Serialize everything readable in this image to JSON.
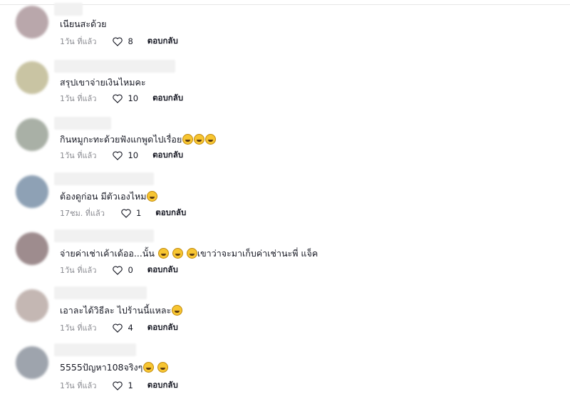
{
  "comments": [
    {
      "text": "เนียนสะด้วย",
      "time": "1วัน ที่แล้ว",
      "likes": "8",
      "reply": "ตอบกลับ",
      "emoji_count": 0,
      "avatar_color": "#b9a7ab"
    },
    {
      "text": "สรุปเขาจ่ายเงินไหมคะ",
      "time": "1วัน ที่แล้ว",
      "likes": "10",
      "reply": "ตอบกลับ",
      "emoji_count": 0,
      "avatar_color": "#c9c4a3"
    },
    {
      "text": "กินหมูกะทะด้วยฟังแกพูดไปเรื่อย",
      "time": "1วัน ที่แล้ว",
      "likes": "10",
      "reply": "ตอบกลับ",
      "emoji_count": 3,
      "avatar_color": "#a9b0a6"
    },
    {
      "text": "ต้องดูก่อน มีตัวเองไหม",
      "time": "17ชม. ที่แล้ว",
      "likes": "1",
      "reply": "ตอบกลับ",
      "emoji_count": 1,
      "avatar_color": "#8ea1b5"
    },
    {
      "text": "จ่ายค่าเช่าเค้าเด้ออ...นั้น",
      "text_after": "เขาว่าจะมาเก็บค่าเช่านะพี่ แจ็ค",
      "time": "1วัน ที่แล้ว",
      "likes": "0",
      "reply": "ตอบกลับ",
      "emoji_count": 3,
      "avatar_color": "#9e8c8e"
    },
    {
      "text": "เอาละได้วิธีละ ไปร้านนี้แหละ",
      "time": "1วัน ที่แล้ว",
      "likes": "4",
      "reply": "ตอบกลับ",
      "emoji_count": 1,
      "avatar_color": "#c4b7b3"
    },
    {
      "text": "5555ปัญหา108จริงๆ",
      "time": "1วัน ที่แล้ว",
      "likes": "1",
      "reply": "ตอบกลับ",
      "emoji_count": 2,
      "avatar_color": "#9ea4ad"
    }
  ]
}
